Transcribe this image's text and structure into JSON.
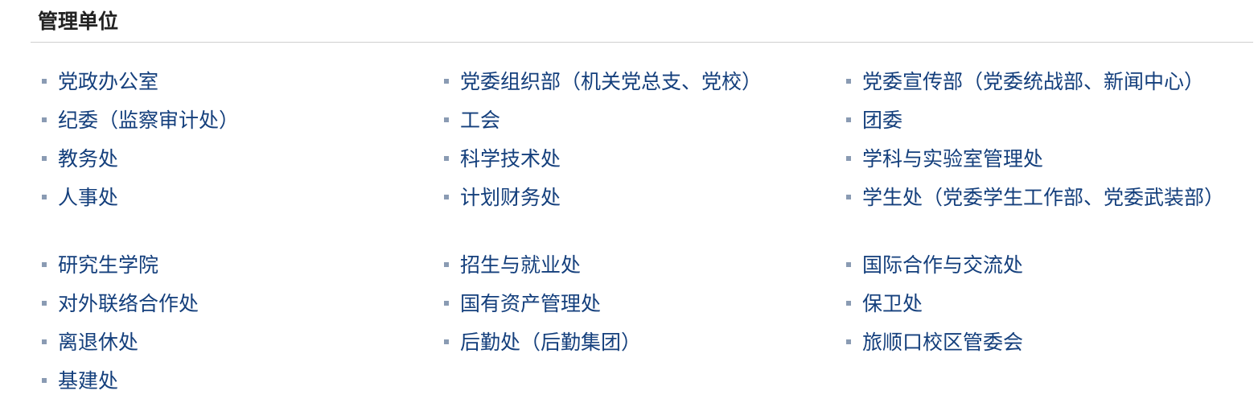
{
  "section": {
    "title": "管理单位"
  },
  "columns": [
    {
      "items": [
        {
          "label": "党政办公室"
        },
        {
          "label": "纪委（监察审计处）"
        },
        {
          "label": "教务处"
        },
        {
          "label": "人事处"
        },
        {
          "label": "研究生学院"
        },
        {
          "label": "对外联络合作处"
        },
        {
          "label": "离退休处"
        },
        {
          "label": "基建处"
        }
      ]
    },
    {
      "items": [
        {
          "label": "党委组织部（机关党总支、党校）"
        },
        {
          "label": "工会"
        },
        {
          "label": "科学技术处"
        },
        {
          "label": "计划财务处"
        },
        {
          "label": "招生与就业处"
        },
        {
          "label": "国有资产管理处"
        },
        {
          "label": "后勤处（后勤集团）"
        }
      ]
    },
    {
      "items": [
        {
          "label": "党委宣传部（党委统战部、新闻中心）"
        },
        {
          "label": "团委"
        },
        {
          "label": "学科与实验室管理处"
        },
        {
          "label": "学生处（党委学生工作部、党委武装部）"
        },
        {
          "label": "国际合作与交流处"
        },
        {
          "label": "保卫处"
        },
        {
          "label": "旅顺口校区管委会"
        }
      ]
    }
  ],
  "colors": {
    "link": "#143f7c",
    "title": "#222222",
    "bullet": "#8a9bb3",
    "divider": "#cfcfcf"
  },
  "icons": {
    "bullet": "square-bullet-icon"
  }
}
